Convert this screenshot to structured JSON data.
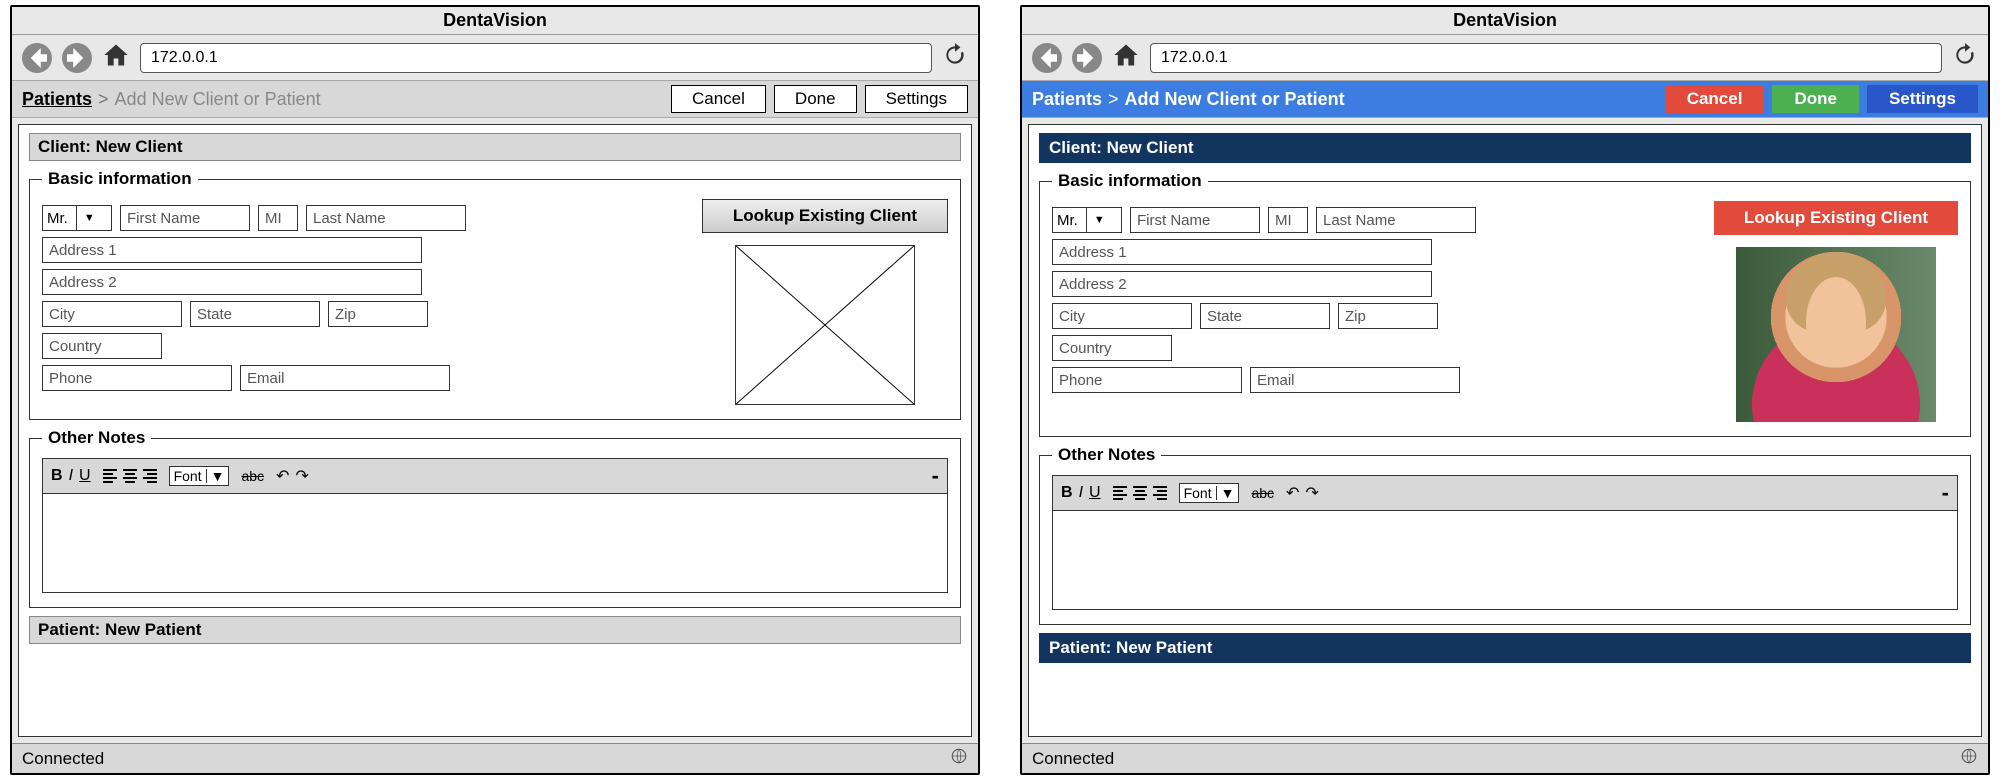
{
  "app_title": "DentaVision",
  "url": "172.0.0.1",
  "breadcrumb": {
    "root": "Patients",
    "sep": ">",
    "current": "Add New Client or Patient"
  },
  "buttons": {
    "cancel": "Cancel",
    "done": "Done",
    "settings": "Settings"
  },
  "client_section": "Client: New Client",
  "patient_section": "Patient: New Patient",
  "basic_legend": "Basic information",
  "notes_legend": "Other Notes",
  "lookup_label": "Lookup Existing Client",
  "fields": {
    "title_option": "Mr.",
    "first_name": "First Name",
    "mi": "MI",
    "last_name": "Last Name",
    "address1": "Address 1",
    "address2": "Address 2",
    "city": "City",
    "state": "State",
    "zip": "Zip",
    "country": "Country",
    "phone": "Phone",
    "email": "Email"
  },
  "rte": {
    "bold": "B",
    "italic": "I",
    "underline": "U",
    "font": "Font",
    "strike": "abc"
  },
  "status": "Connected"
}
